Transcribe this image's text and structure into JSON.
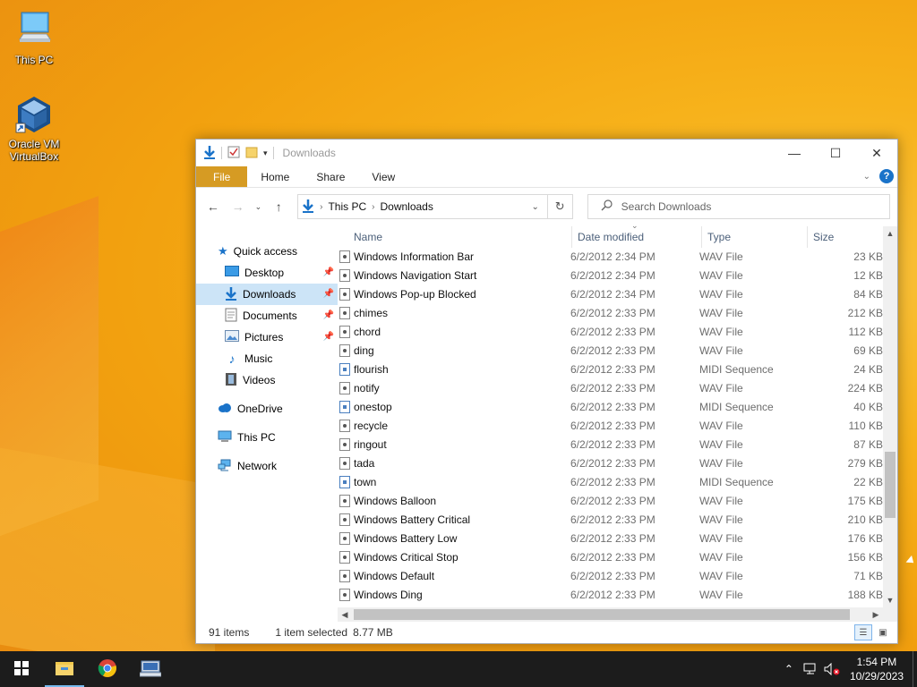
{
  "desktop": {
    "icons": [
      {
        "label": "This PC",
        "icon": "computer-icon"
      },
      {
        "label": "Oracle VM VirtualBox",
        "icon": "virtualbox-icon"
      }
    ]
  },
  "window": {
    "title": "Downloads",
    "ribbon_tabs": [
      "File",
      "Home",
      "Share",
      "View"
    ],
    "address": {
      "crumbs": [
        "This PC",
        "Downloads"
      ]
    },
    "search_placeholder": "Search Downloads",
    "nav_pane": {
      "quick_access": "Quick access",
      "pinned": [
        {
          "label": "Desktop",
          "icon": "desktop-icon",
          "pinned": true
        },
        {
          "label": "Downloads",
          "icon": "download-arrow-icon",
          "pinned": true,
          "selected": true
        },
        {
          "label": "Documents",
          "icon": "documents-icon",
          "pinned": true
        },
        {
          "label": "Pictures",
          "icon": "pictures-icon",
          "pinned": true
        },
        {
          "label": "Music",
          "icon": "music-icon",
          "pinned": false
        },
        {
          "label": "Videos",
          "icon": "videos-icon",
          "pinned": false
        }
      ],
      "onedrive": "OneDrive",
      "this_pc": "This PC",
      "network": "Network"
    },
    "columns": {
      "name": "Name",
      "date": "Date modified",
      "type": "Type",
      "size": "Size"
    },
    "files": [
      {
        "name": "Windows Information Bar",
        "date": "6/2/2012 2:34 PM",
        "type": "WAV File",
        "size": "23 KB"
      },
      {
        "name": "Windows Navigation Start",
        "date": "6/2/2012 2:34 PM",
        "type": "WAV File",
        "size": "12 KB"
      },
      {
        "name": "Windows Pop-up Blocked",
        "date": "6/2/2012 2:34 PM",
        "type": "WAV File",
        "size": "84 KB"
      },
      {
        "name": "chimes",
        "date": "6/2/2012 2:33 PM",
        "type": "WAV File",
        "size": "212 KB"
      },
      {
        "name": "chord",
        "date": "6/2/2012 2:33 PM",
        "type": "WAV File",
        "size": "112 KB"
      },
      {
        "name": "ding",
        "date": "6/2/2012 2:33 PM",
        "type": "WAV File",
        "size": "69 KB"
      },
      {
        "name": "flourish",
        "date": "6/2/2012 2:33 PM",
        "type": "MIDI Sequence",
        "size": "24 KB"
      },
      {
        "name": "notify",
        "date": "6/2/2012 2:33 PM",
        "type": "WAV File",
        "size": "224 KB"
      },
      {
        "name": "onestop",
        "date": "6/2/2012 2:33 PM",
        "type": "MIDI Sequence",
        "size": "40 KB"
      },
      {
        "name": "recycle",
        "date": "6/2/2012 2:33 PM",
        "type": "WAV File",
        "size": "110 KB"
      },
      {
        "name": "ringout",
        "date": "6/2/2012 2:33 PM",
        "type": "WAV File",
        "size": "87 KB"
      },
      {
        "name": "tada",
        "date": "6/2/2012 2:33 PM",
        "type": "WAV File",
        "size": "279 KB"
      },
      {
        "name": "town",
        "date": "6/2/2012 2:33 PM",
        "type": "MIDI Sequence",
        "size": "22 KB"
      },
      {
        "name": "Windows Balloon",
        "date": "6/2/2012 2:33 PM",
        "type": "WAV File",
        "size": "175 KB"
      },
      {
        "name": "Windows Battery Critical",
        "date": "6/2/2012 2:33 PM",
        "type": "WAV File",
        "size": "210 KB"
      },
      {
        "name": "Windows Battery Low",
        "date": "6/2/2012 2:33 PM",
        "type": "WAV File",
        "size": "176 KB"
      },
      {
        "name": "Windows Critical Stop",
        "date": "6/2/2012 2:33 PM",
        "type": "WAV File",
        "size": "156 KB"
      },
      {
        "name": "Windows Default",
        "date": "6/2/2012 2:33 PM",
        "type": "WAV File",
        "size": "71 KB"
      },
      {
        "name": "Windows Ding",
        "date": "6/2/2012 2:33 PM",
        "type": "WAV File",
        "size": "188 KB"
      }
    ],
    "status": {
      "count": "91 items",
      "selection": "1 item selected",
      "selection_size": "8.77 MB"
    }
  },
  "taskbar": {
    "apps": [
      {
        "name": "start-icon"
      },
      {
        "name": "file-explorer-icon",
        "active": true
      },
      {
        "name": "chrome-icon"
      },
      {
        "name": "network-app-icon"
      }
    ],
    "clock": {
      "time": "1:54 PM",
      "date": "10/29/2023"
    }
  },
  "colors": {
    "accent": "#0078d7",
    "file_tab": "#d69b23",
    "selected": "#cce4f7",
    "taskbar": "#1c1c1c"
  }
}
